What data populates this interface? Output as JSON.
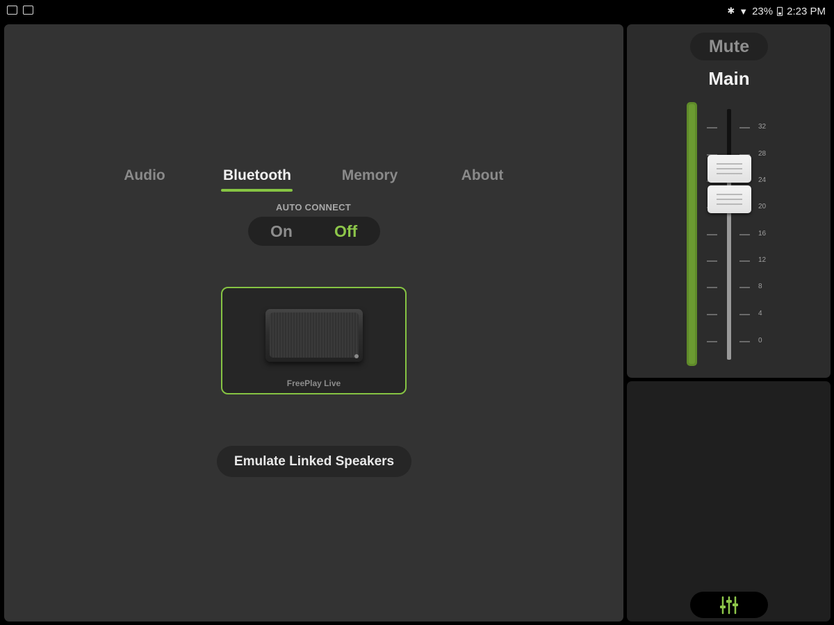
{
  "status_bar": {
    "left_icons": [
      "image-icon",
      "checklist-icon"
    ],
    "battery": "23%",
    "time": "2:23 PM"
  },
  "tabs": [
    {
      "label": "Audio",
      "active": false
    },
    {
      "label": "Bluetooth",
      "active": true
    },
    {
      "label": "Memory",
      "active": false
    },
    {
      "label": "About",
      "active": false
    }
  ],
  "auto_connect": {
    "label": "AUTO CONNECT",
    "on_label": "On",
    "off_label": "Off",
    "selected": "Off"
  },
  "speaker": {
    "name": "FreePlay Live"
  },
  "emulate_button": "Emulate Linked Speakers",
  "mixer": {
    "mute_label": "Mute",
    "channel_label": "Main",
    "scale": [
      "32",
      "28",
      "24",
      "20",
      "16",
      "12",
      "8",
      "4",
      "0"
    ]
  },
  "colors": {
    "accent": "#86c443",
    "panel": "#333333",
    "background": "#000000"
  }
}
